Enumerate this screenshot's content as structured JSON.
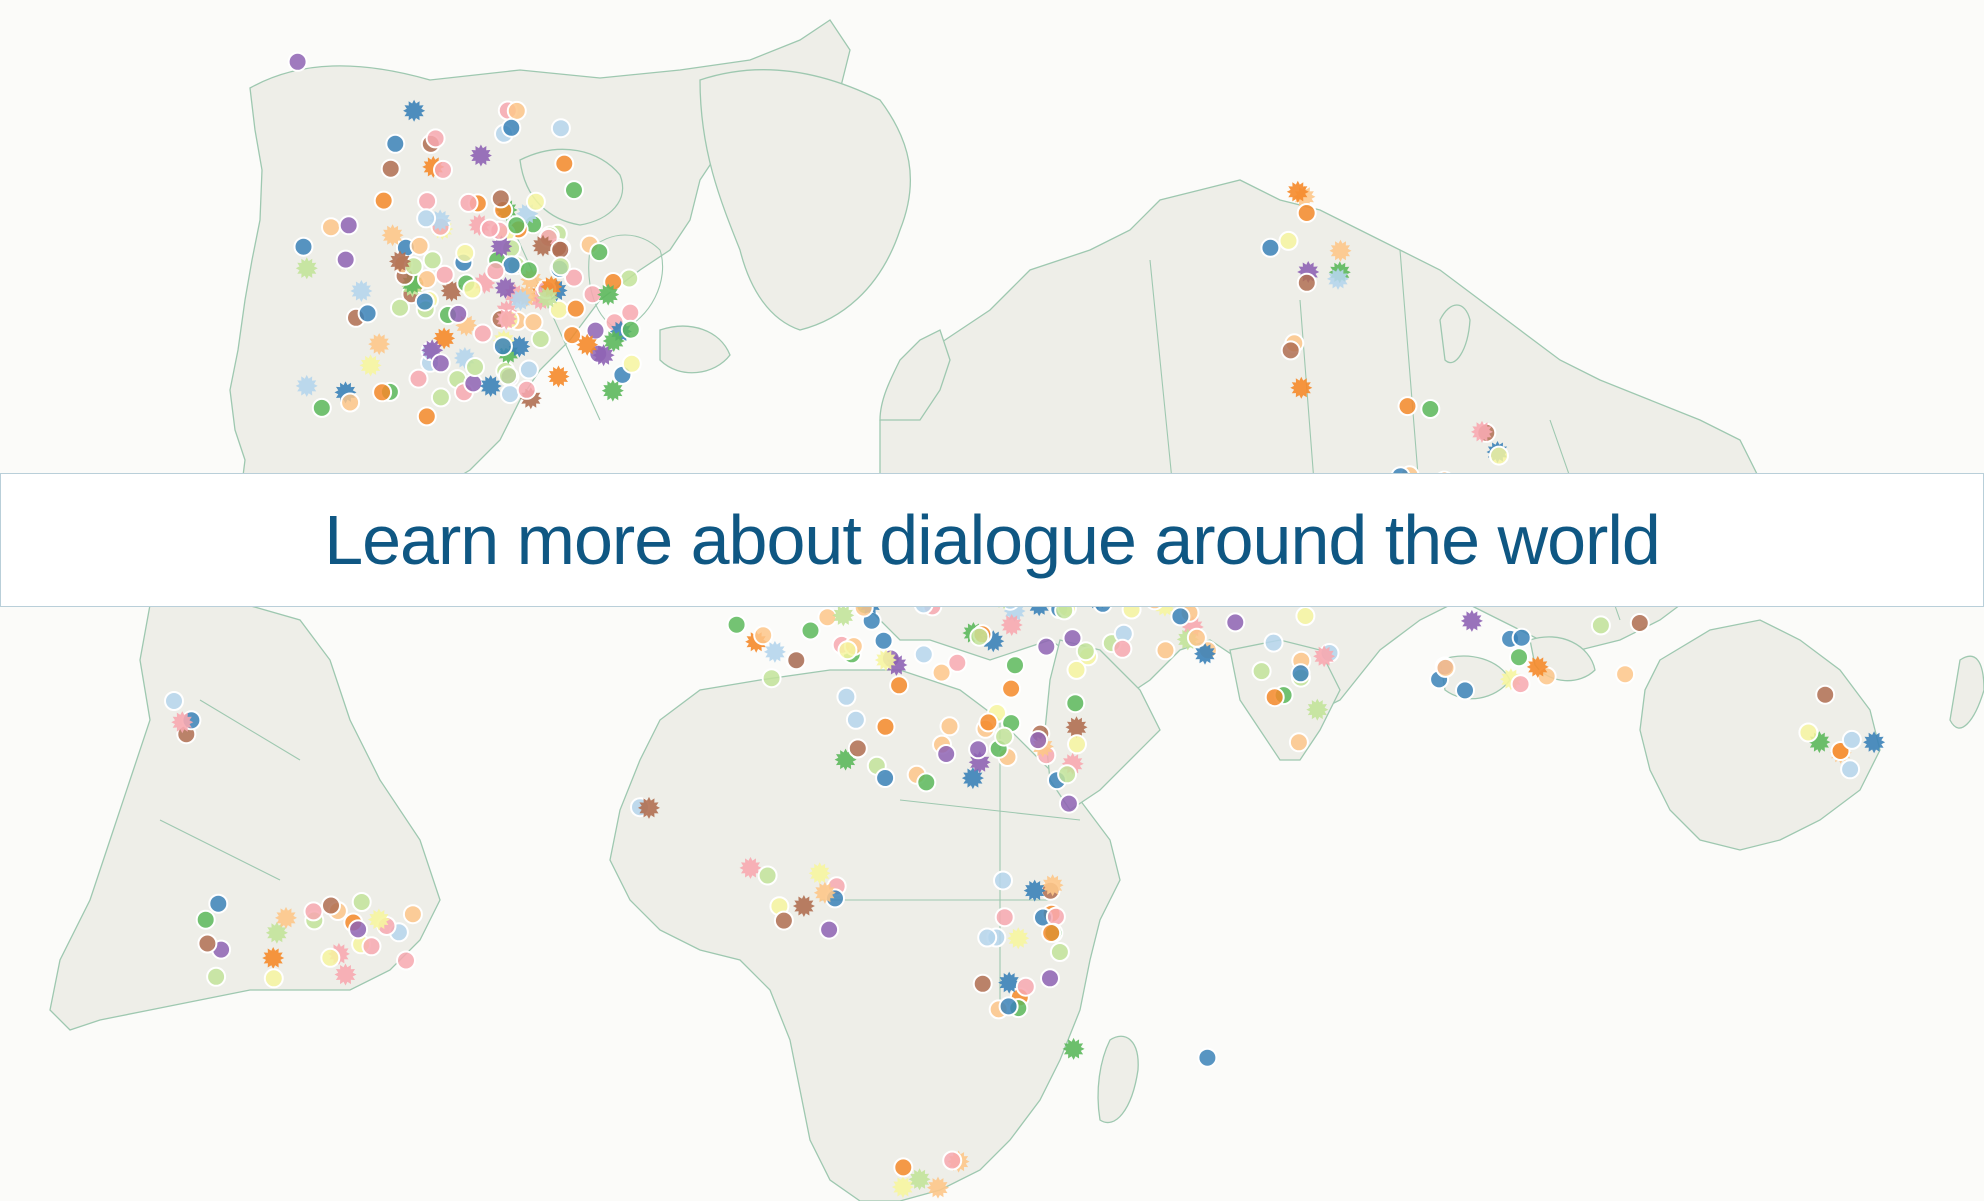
{
  "banner": {
    "label": "Learn more about dialogue around the world"
  },
  "palette": {
    "pink": "#f7a8b0",
    "light_orange": "#fdc68a",
    "orange": "#f58a2a",
    "green": "#5cb85c",
    "light_green": "#c2e39a",
    "purple": "#8e63b4",
    "brown": "#b06f52",
    "blue": "#3b82b8",
    "light_blue": "#b5d5ec",
    "yellow": "#f6f5a0",
    "land": "#eeeee8",
    "border": "#9ec8b0",
    "ocean": "#fbfbf9"
  },
  "marker_legend_note": "",
  "icons": {
    "circle": "dialogue-marker-circle",
    "burst": "dialogue-marker-burst"
  }
}
